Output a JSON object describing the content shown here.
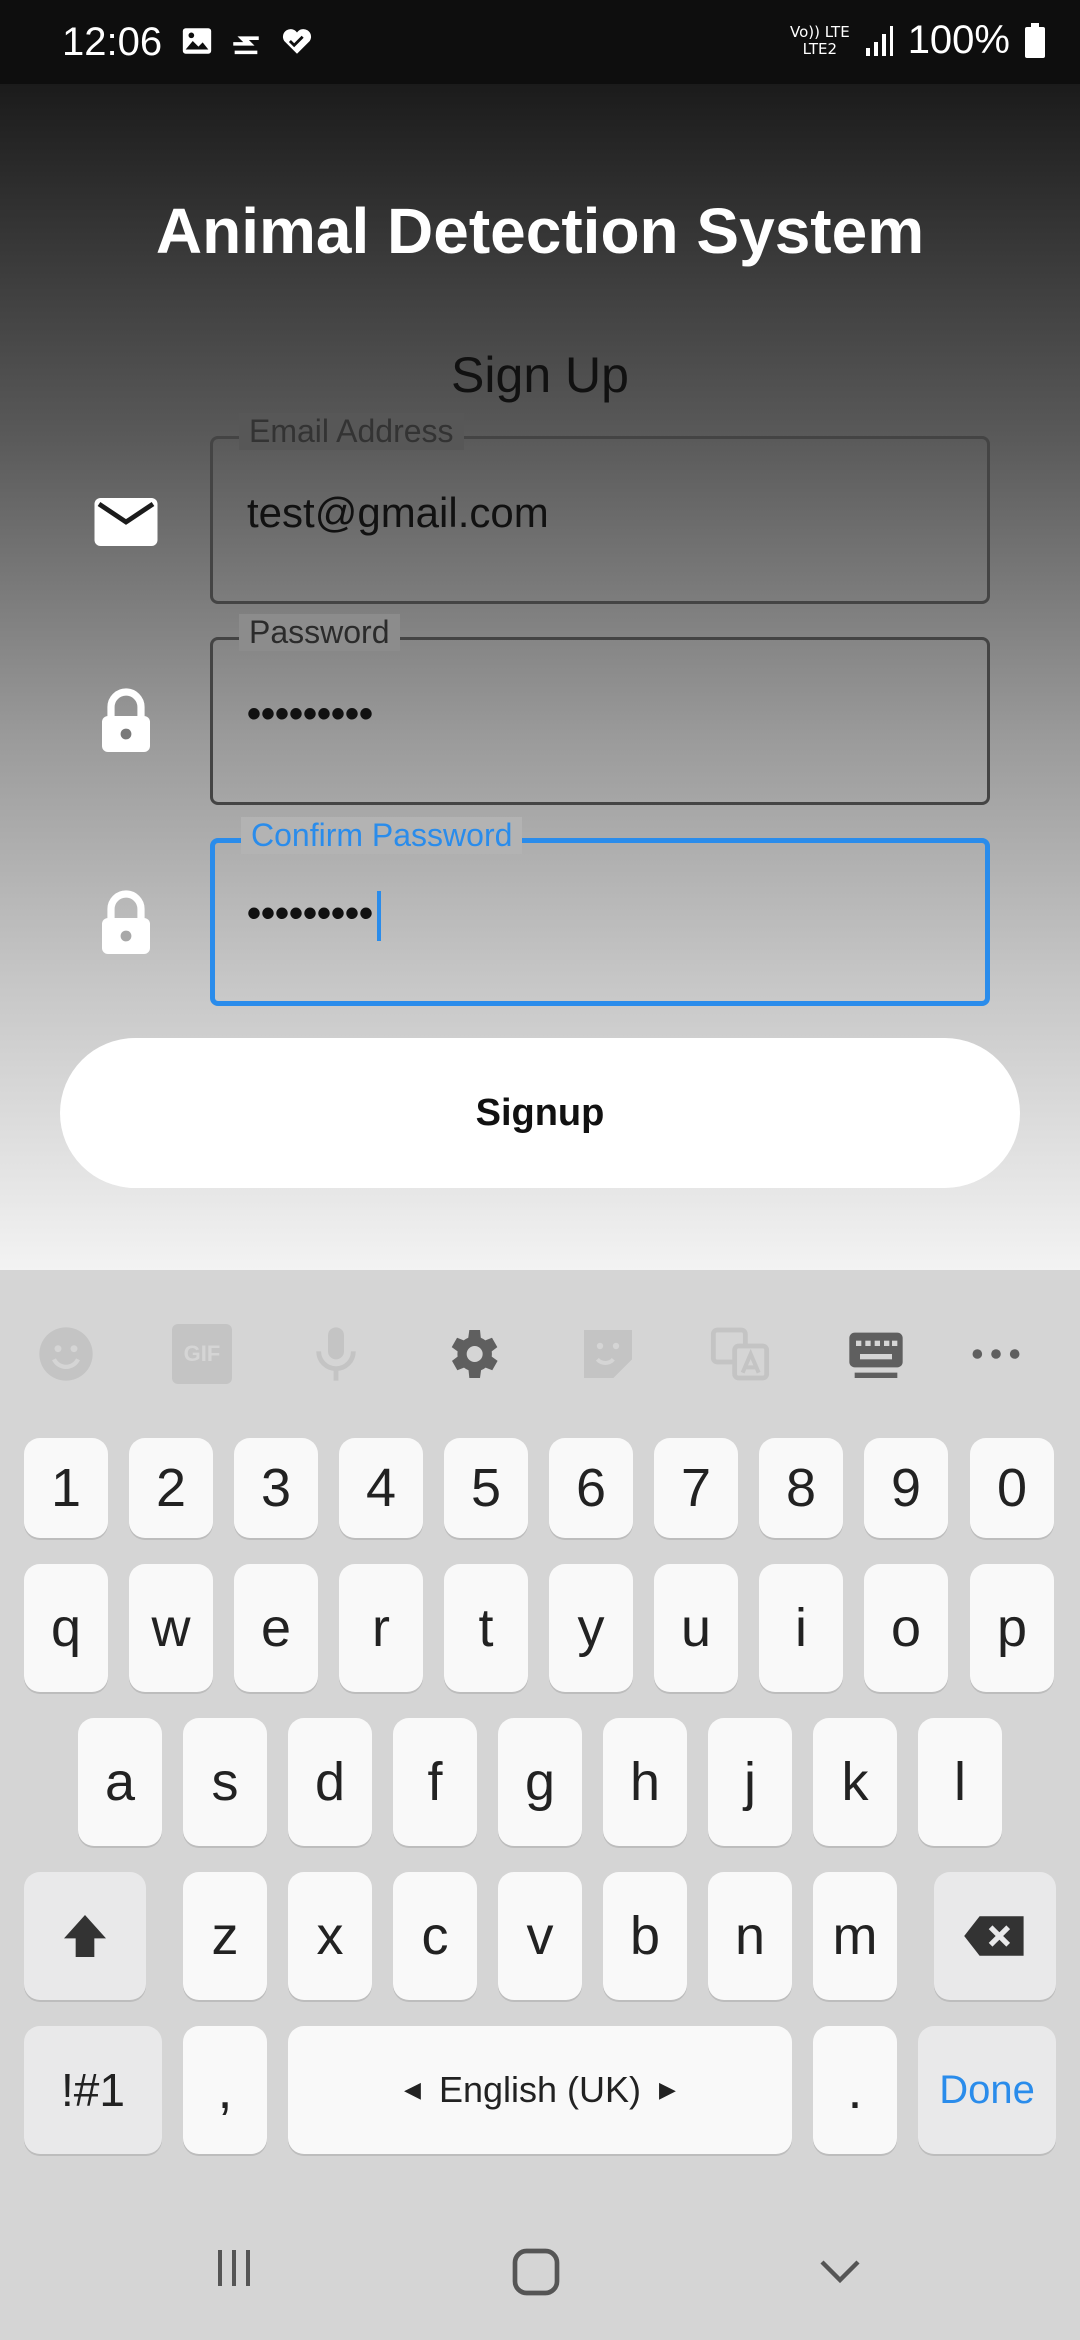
{
  "status_bar": {
    "time": "12:06",
    "battery_text": "100%",
    "network_top": "Vo)) LTE",
    "network_bottom": "LTE2"
  },
  "app": {
    "title": "Animal Detection System",
    "form_title": "Sign Up",
    "email": {
      "label": "Email Address",
      "value": "test@gmail.com"
    },
    "password": {
      "label": "Password",
      "value": "•••••••••"
    },
    "confirm_password": {
      "label": "Confirm Password",
      "value": "•••••••••"
    },
    "signup_label": "Signup",
    "focus_color": "#2a8ceb"
  },
  "keyboard": {
    "toolbar_icons": [
      "emoji-icon",
      "gif-icon",
      "microphone-icon",
      "settings-icon",
      "sticker-icon",
      "translate-icon",
      "keyboard-icon",
      "more-icon"
    ],
    "gif_label": "GIF",
    "number_row": [
      "1",
      "2",
      "3",
      "4",
      "5",
      "6",
      "7",
      "8",
      "9",
      "0"
    ],
    "row1": [
      "q",
      "w",
      "e",
      "r",
      "t",
      "y",
      "u",
      "i",
      "o",
      "p"
    ],
    "row2": [
      "a",
      "s",
      "d",
      "f",
      "g",
      "h",
      "j",
      "k",
      "l"
    ],
    "row3": [
      "z",
      "x",
      "c",
      "v",
      "b",
      "n",
      "m"
    ],
    "symbols_label": "!#1",
    "comma_label": ",",
    "space_label": "English (UK)",
    "period_label": ".",
    "done_label": "Done"
  }
}
